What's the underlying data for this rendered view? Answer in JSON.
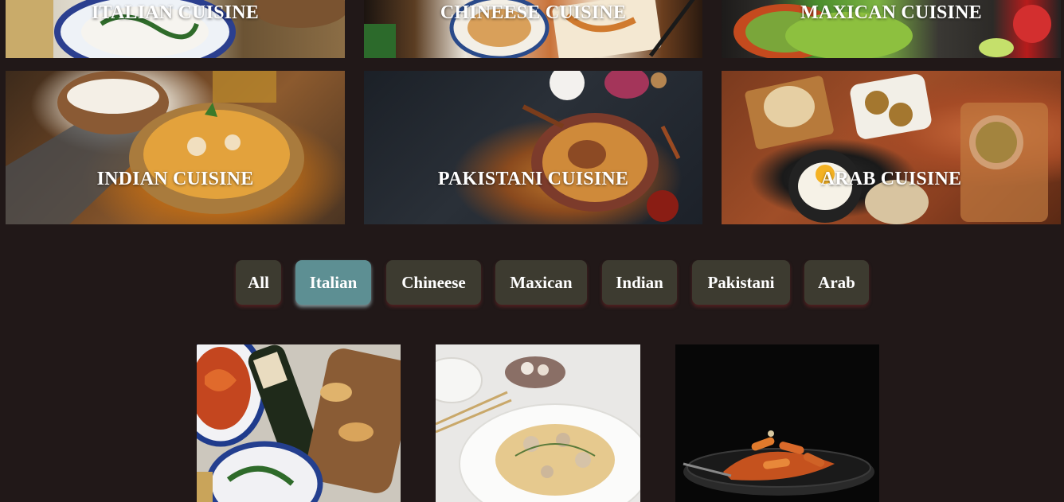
{
  "cuisines": [
    {
      "title": "ITALIAN CUISINE"
    },
    {
      "title": "CHINEESE CUISINE"
    },
    {
      "title": "MAXICAN CUISINE"
    },
    {
      "title": "INDIAN CUISINE"
    },
    {
      "title": "PAKISTANI CUISINE"
    },
    {
      "title": "ARAB CUISINE"
    }
  ],
  "filters": {
    "active": "Italian",
    "items": [
      "All",
      "Italian",
      "Chineese",
      "Maxican",
      "Indian",
      "Pakistani",
      "Arab"
    ]
  },
  "dishes": [
    {
      "icon": "italian-platter-photo"
    },
    {
      "icon": "mushroom-pasta-photo"
    },
    {
      "icon": "penne-pasta-photo"
    }
  ],
  "colors": {
    "background": "#211818",
    "button": "#3d3b30",
    "button_active": "#5d8f93",
    "text": "#ffffff"
  }
}
